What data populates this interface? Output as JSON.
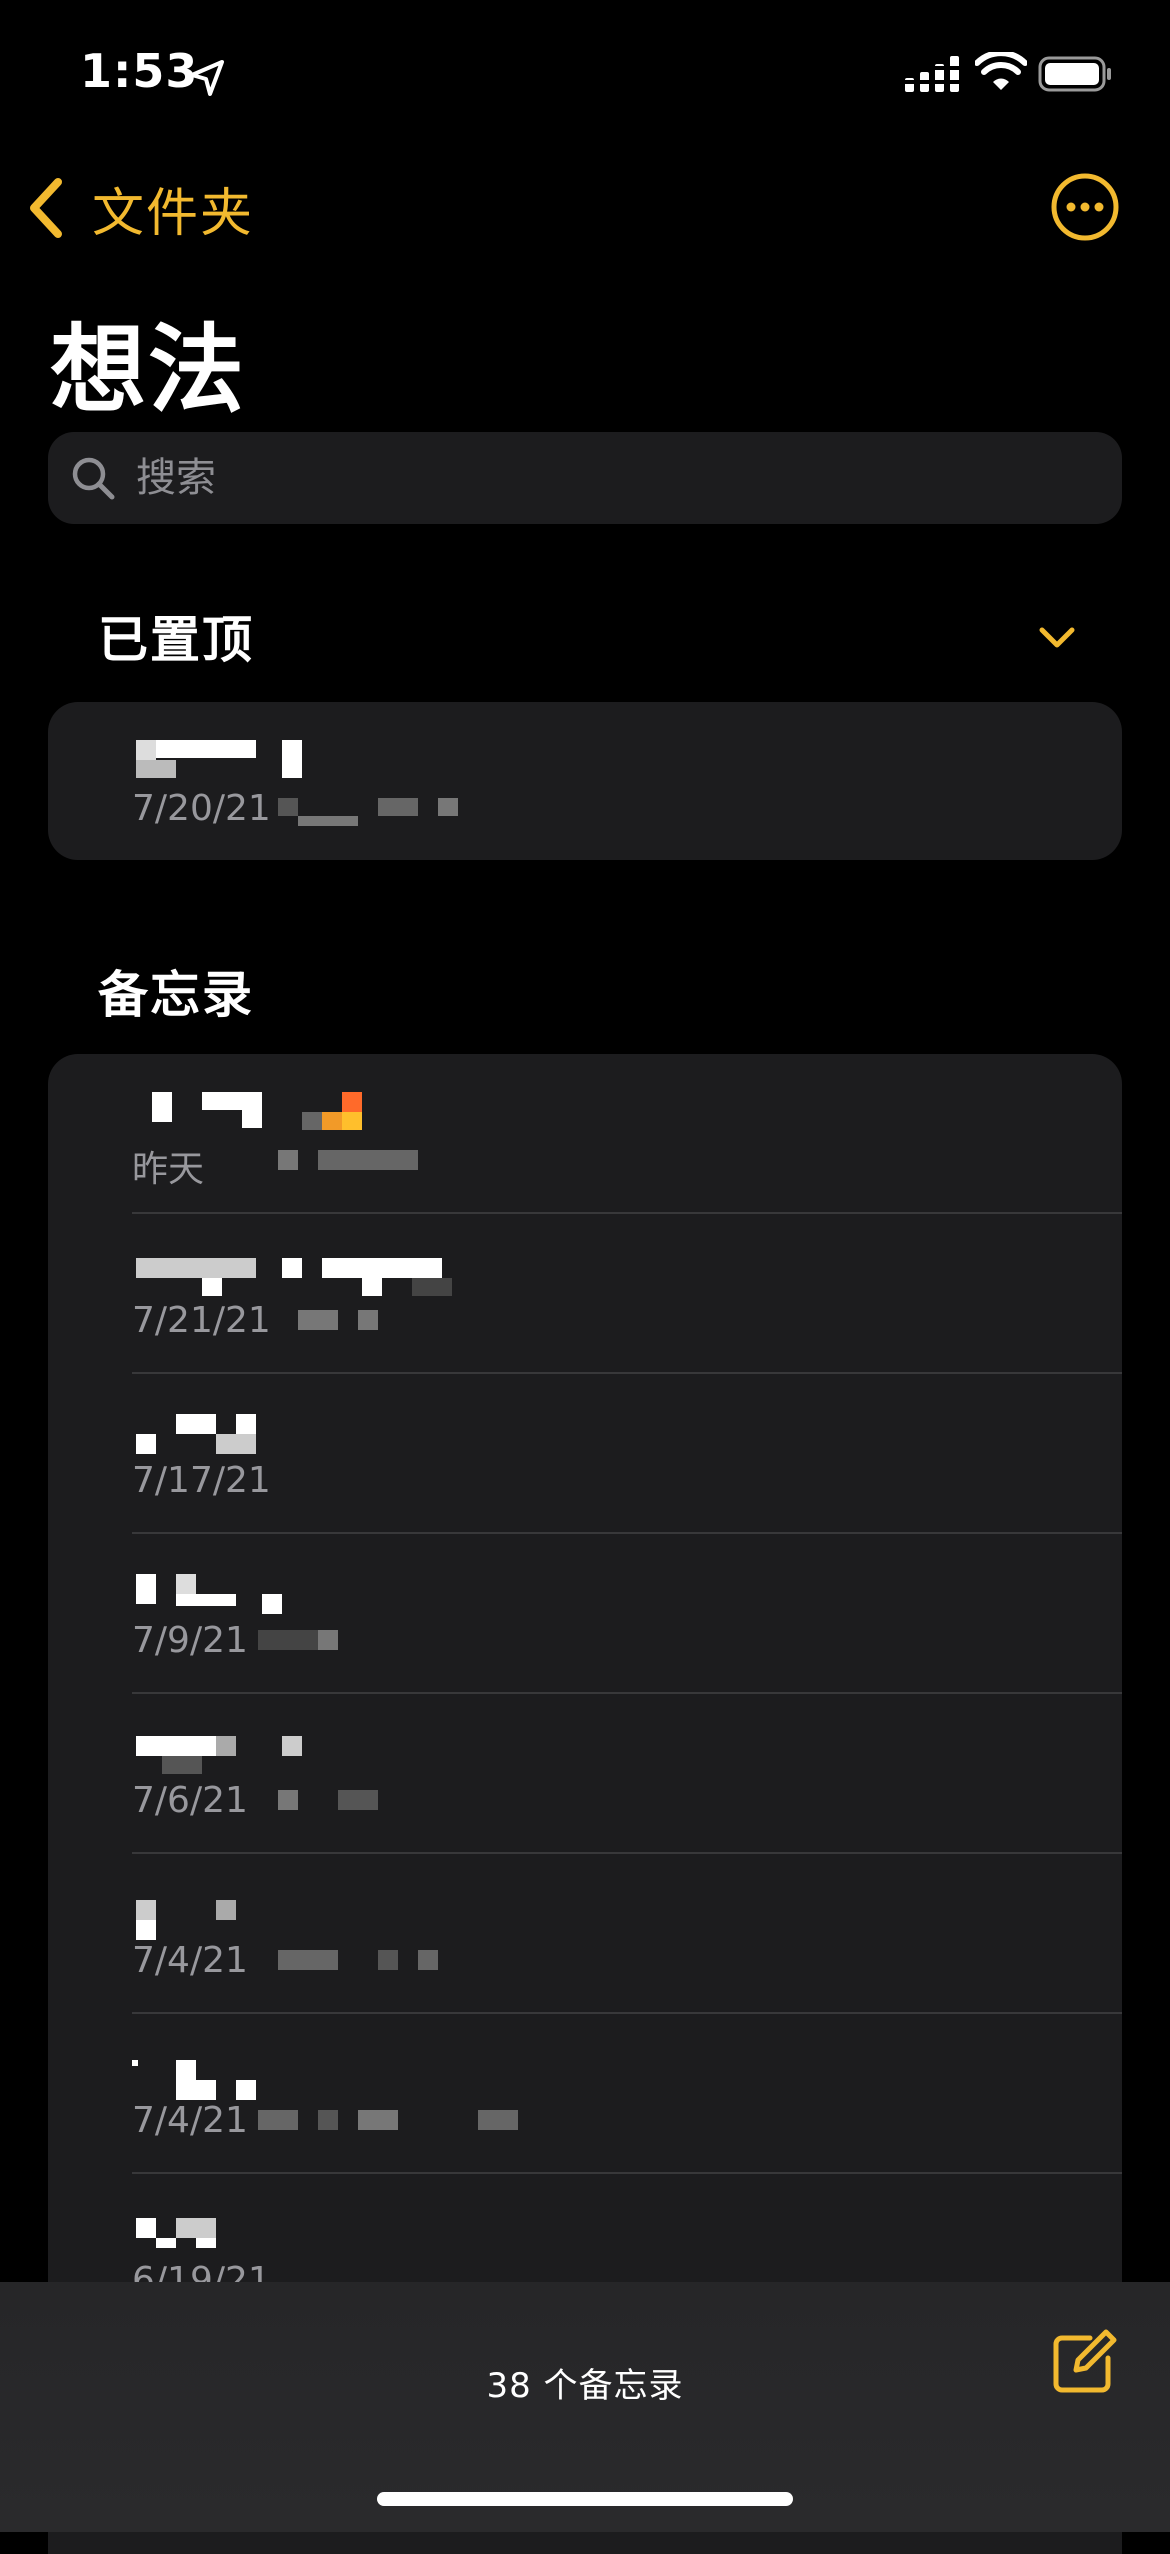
{
  "status_bar": {
    "time": "1:53"
  },
  "nav": {
    "back_label": "文件夹"
  },
  "page": {
    "title": "想法"
  },
  "search": {
    "placeholder": "搜索"
  },
  "sections": {
    "pinned": "已置顶",
    "notes": "备忘录"
  },
  "pinned_notes": [
    {
      "date": "7/20/21"
    }
  ],
  "notes": [
    {
      "date": "昨天"
    },
    {
      "date": "7/21/21"
    },
    {
      "date": "7/17/21"
    },
    {
      "date": "7/9/21"
    },
    {
      "date": "7/6/21"
    },
    {
      "date": "7/4/21"
    },
    {
      "date": "7/4/21"
    },
    {
      "date": "6/19/21"
    }
  ],
  "toolbar": {
    "count_label": "38 个备忘录"
  },
  "colors": {
    "accent": "#f2b92f",
    "background": "#000000",
    "card": "#1c1c1e",
    "secondary_text": "#98989d"
  },
  "icons": [
    "location-arrow-icon",
    "cellular-signal-icon",
    "wifi-icon",
    "battery-icon",
    "chevron-left-icon",
    "ellipsis-circle-icon",
    "search-icon",
    "chevron-down-icon",
    "compose-icon"
  ]
}
